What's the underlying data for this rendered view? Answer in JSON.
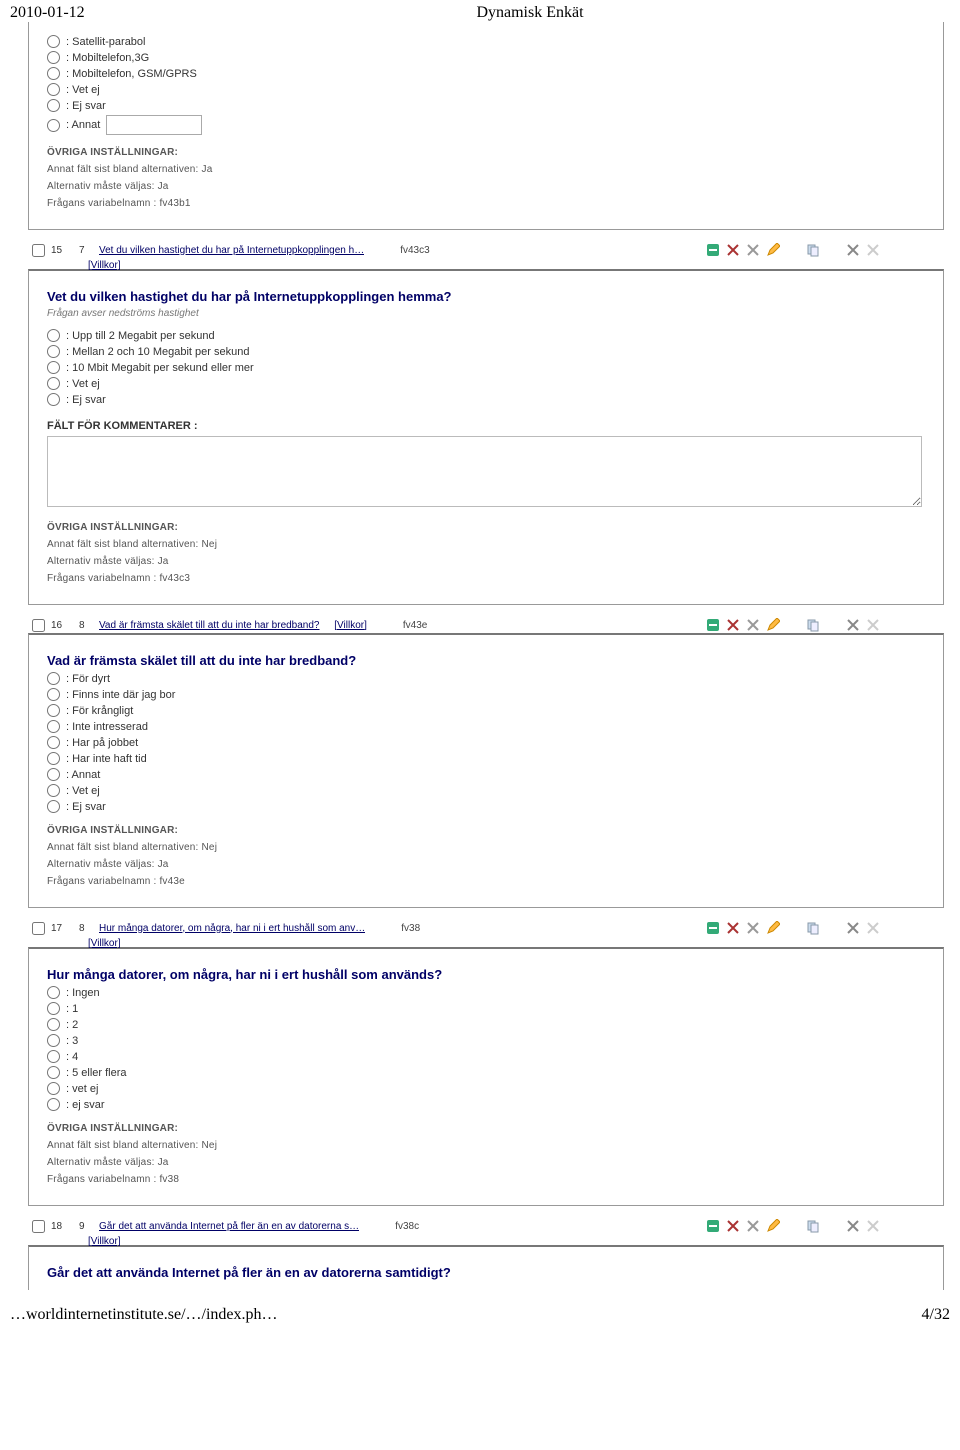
{
  "header": {
    "date": "2010-01-12",
    "title": "Dynamisk Enkät"
  },
  "footer": {
    "url": "…worldinternetinstitute.se/…/index.ph…",
    "pager": "4/32"
  },
  "labels": {
    "villkor": "[Villkor]",
    "ovriga": "ÖVRIGA INSTÄLLNINGAR:",
    "annat_sist": "Annat fält sist bland alternativen:",
    "alt_valjas": "Alternativ måste väljas:",
    "varnamn": "Frågans variabelnamn :",
    "falt_komm": "FÄLT FÖR KOMMENTARER :",
    "ja": "Ja",
    "nej": "Nej"
  },
  "q_prev": {
    "options": [
      ": Satellit-parabol",
      ": Mobiltelefon,3G",
      ": Mobiltelefon, GSM/GPRS",
      ": Vet ej",
      ": Ej svar",
      ": Annat"
    ],
    "annat_sist": "Ja",
    "varnamn": "fv43b1"
  },
  "q15": {
    "pnum": "15",
    "qnum": "7",
    "link": "Vet du vilken hastighet du har på Internetuppkopplingen h…",
    "code": "fv43c3",
    "title": "Vet du vilken hastighet du har på Internetuppkopplingen hemma?",
    "sub": "Frågan avser nedströms hastighet",
    "options": [
      ": Upp till 2 Megabit per sekund",
      ": Mellan 2 och 10 Megabit per sekund",
      ": 10 Mbit Megabit per sekund eller mer",
      ": Vet ej",
      ": Ej svar"
    ],
    "annat_sist": "Nej",
    "varnamn": "fv43c3"
  },
  "q16": {
    "pnum": "16",
    "qnum": "8",
    "link": "Vad är främsta skälet till att du inte har bredband?",
    "code": "fv43e",
    "title": "Vad är främsta skälet till att du inte har bredband?",
    "options": [
      ": För dyrt",
      ": Finns inte där jag bor",
      ": För krångligt",
      ": Inte intresserad",
      ": Har på jobbet",
      ": Har inte haft tid",
      ": Annat",
      ": Vet ej",
      ": Ej svar"
    ],
    "annat_sist": "Nej",
    "varnamn": "fv43e"
  },
  "q17": {
    "pnum": "17",
    "qnum": "8",
    "link": "Hur många datorer, om några, har ni i ert hushåll som anv…",
    "code": "fv38",
    "title": "Hur många datorer, om några, har ni i ert hushåll som används?",
    "options": [
      ": Ingen",
      ": 1",
      ": 2",
      ": 3",
      ": 4",
      ": 5 eller flera",
      ": vet ej",
      ": ej svar"
    ],
    "annat_sist": "Nej",
    "varnamn": "fv38"
  },
  "q18": {
    "pnum": "18",
    "qnum": "9",
    "link": "Går det att använda Internet på fler än en av datorerna s…",
    "code": "fv38c",
    "title": "Går det att använda Internet på fler än en av datorerna samtidigt?"
  }
}
